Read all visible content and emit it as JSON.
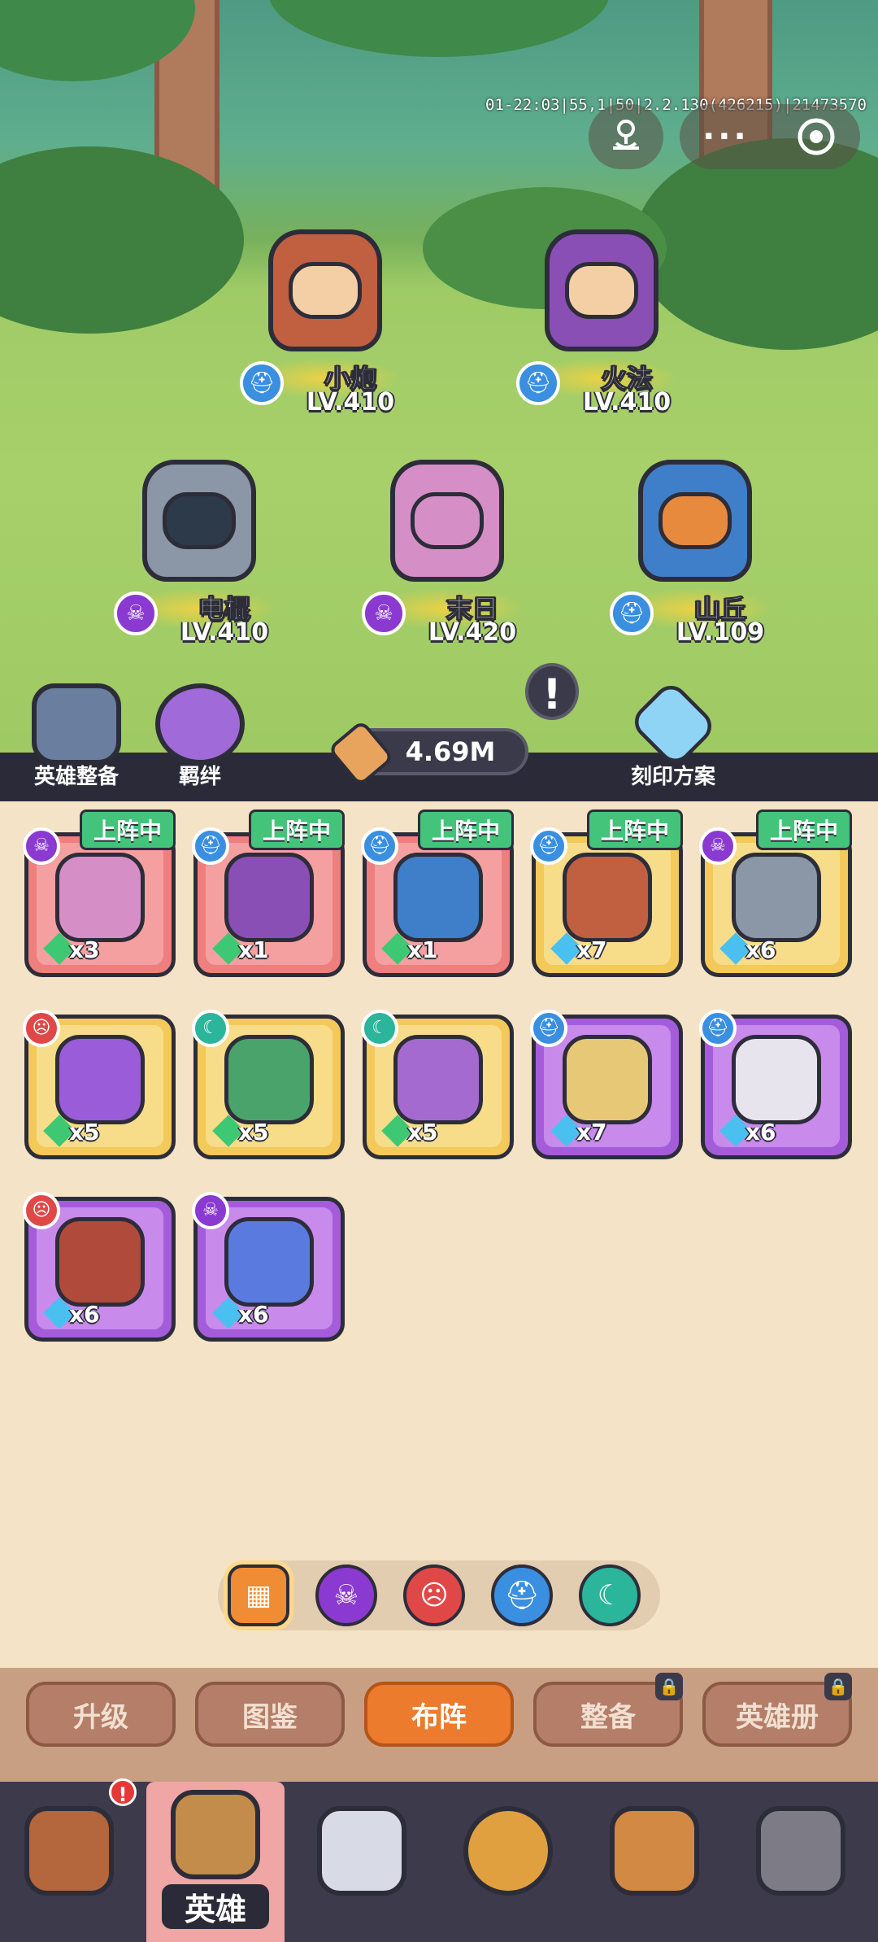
{
  "debug_text": "01-22:03|55,1|50|2.2.130(426215)|21473570",
  "capsule": {
    "mini_program_icon": "joystick-icon",
    "more_icon": "more-dots-icon",
    "close_icon": "target-icon"
  },
  "lineup": [
    {
      "name": "小炮",
      "level": "LV.410",
      "class": "tank"
    },
    {
      "name": "火法",
      "level": "LV.410",
      "class": "tank"
    },
    {
      "name": "电棍",
      "level": "LV.410",
      "class": "skull"
    },
    {
      "name": "末日",
      "level": "LV.420",
      "class": "skull"
    },
    {
      "name": "山丘",
      "level": "LV.109",
      "class": "tank"
    }
  ],
  "buttons": {
    "equip": "英雄整备",
    "bond": "羁绊",
    "engrave": "刻印方案"
  },
  "power": "4.69M",
  "heroes": [
    {
      "tag": "上阵中",
      "count": "x3",
      "frame": "red",
      "class": "skull"
    },
    {
      "tag": "上阵中",
      "count": "x1",
      "frame": "red",
      "class": "tank"
    },
    {
      "tag": "上阵中",
      "count": "x1",
      "frame": "red",
      "class": "tank"
    },
    {
      "tag": "上阵中",
      "count": "x7",
      "frame": "gold",
      "class": "tank"
    },
    {
      "tag": "上阵中",
      "count": "x6",
      "frame": "gold",
      "class": "skull"
    },
    {
      "tag": "",
      "count": "x5",
      "frame": "gold",
      "class": "rage"
    },
    {
      "tag": "",
      "count": "x5",
      "frame": "gold",
      "class": "moon"
    },
    {
      "tag": "",
      "count": "x5",
      "frame": "gold",
      "class": "moon"
    },
    {
      "tag": "",
      "count": "x7",
      "frame": "purp",
      "class": "tank"
    },
    {
      "tag": "",
      "count": "x6",
      "frame": "purp",
      "class": "tank"
    },
    {
      "tag": "",
      "count": "x6",
      "frame": "purp",
      "class": "rage"
    },
    {
      "tag": "",
      "count": "x6",
      "frame": "purp",
      "class": "skull"
    }
  ],
  "filters": [
    "all-icon",
    "skull-icon",
    "rage-icon",
    "helmet-icon",
    "moon-icon"
  ],
  "tabs": [
    {
      "label": "升级",
      "active": false,
      "locked": false
    },
    {
      "label": "图鉴",
      "active": false,
      "locked": false
    },
    {
      "label": "布阵",
      "active": true,
      "locked": false
    },
    {
      "label": "整备",
      "active": false,
      "locked": true
    },
    {
      "label": "英雄册",
      "active": false,
      "locked": true
    }
  ],
  "nav": {
    "hero_label": "英雄",
    "badge": "!"
  },
  "colors": {
    "accent": "#ec7b2e",
    "deployed_tag": "#43c47a",
    "background": "#f4e3c6"
  }
}
